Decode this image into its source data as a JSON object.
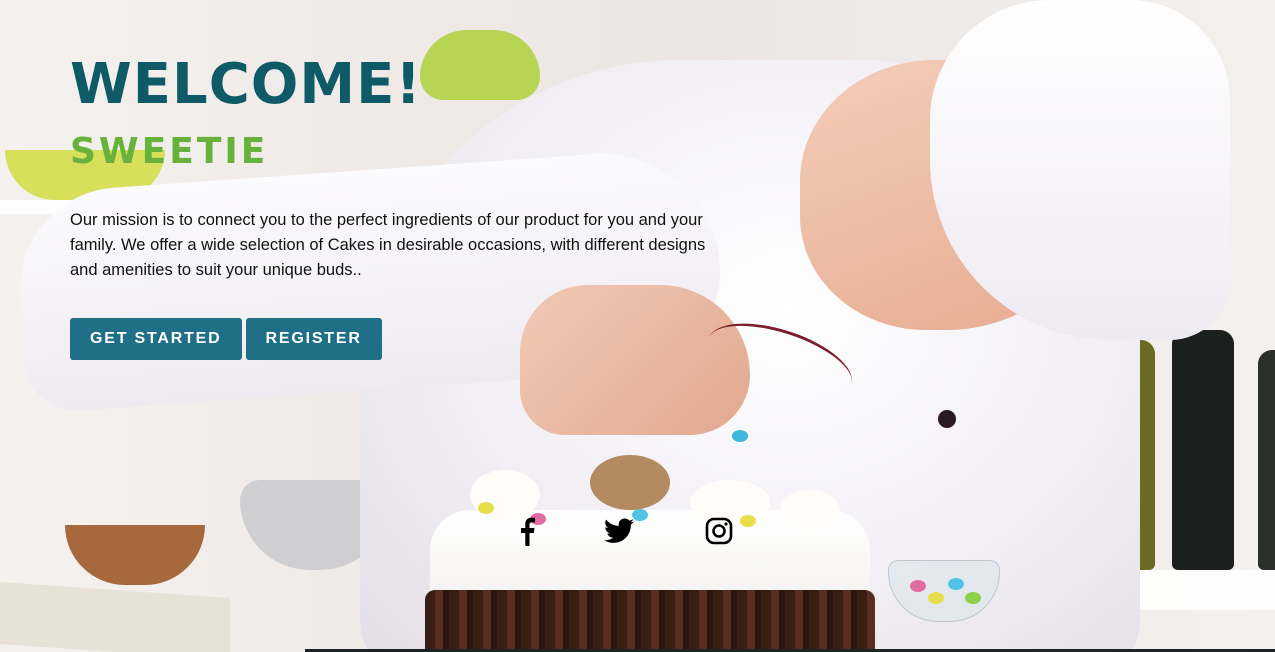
{
  "hero": {
    "title": "WELCOME!",
    "subtitle": "SWEETIE",
    "mission": "Our mission is to connect you to the perfect ingredients of our product for you and your family. We offer a wide selection of Cakes in desirable occasions, with different designs and amenities to suit your unique buds.."
  },
  "buttons": {
    "get_started": "GET STARTED",
    "register": "REGISTER"
  },
  "social": [
    {
      "name": "facebook-icon"
    },
    {
      "name": "twitter-icon"
    },
    {
      "name": "instagram-icon"
    }
  ],
  "colors": {
    "title": "#0e5a66",
    "subtitle": "#67b23b",
    "button": "#1f6f87"
  }
}
